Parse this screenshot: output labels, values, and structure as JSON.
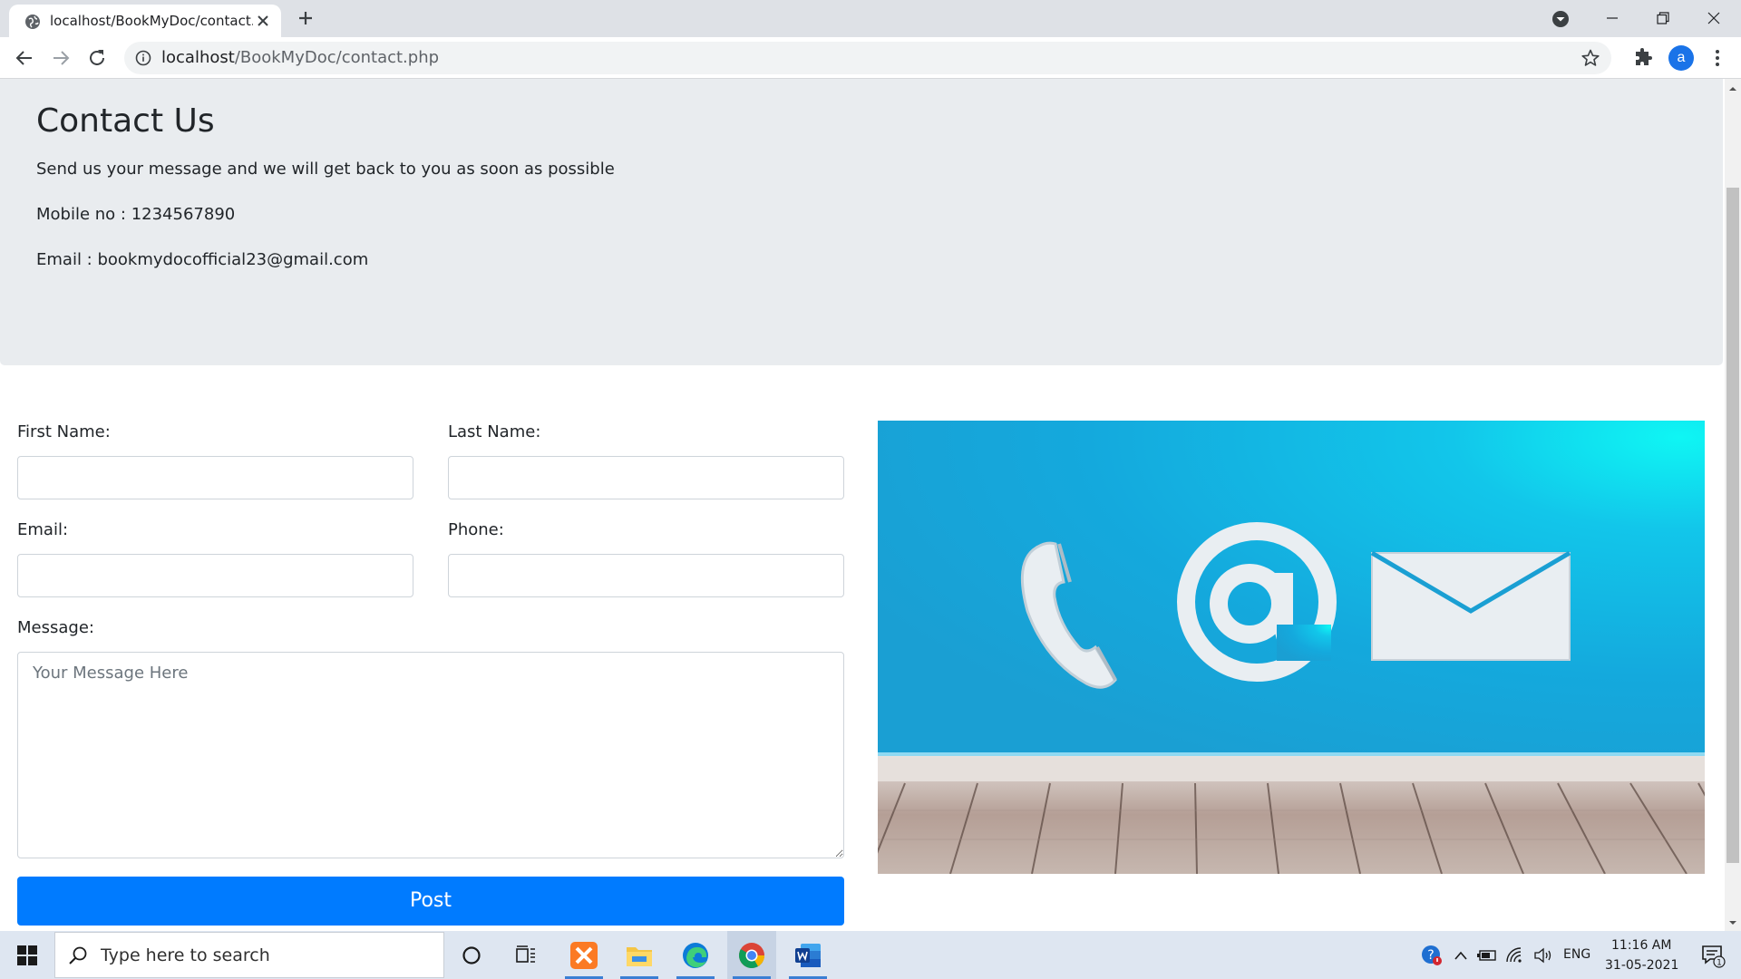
{
  "browser": {
    "tab_title": "localhost/BookMyDoc/contact.php",
    "url_host": "localhost",
    "url_path": "/BookMyDoc/contact.php",
    "avatar_letter": "a"
  },
  "jumbotron": {
    "heading": "Contact Us",
    "lead": "Send us your message and we will get back to you as soon as possible",
    "mobile": "Mobile no : 1234567890",
    "email": "Email : bookmydocofficial23@gmail.com"
  },
  "form": {
    "first_name_label": "First Name:",
    "last_name_label": "Last Name:",
    "email_label": "Email:",
    "phone_label": "Phone:",
    "message_label": "Message:",
    "message_placeholder": "Your Message Here",
    "post_label": "Post"
  },
  "taskbar": {
    "search_placeholder": "Type here to search",
    "language": "ENG",
    "time": "11:16 AM",
    "date": "31-05-2021",
    "notification_count": "1"
  },
  "colors": {
    "primary": "#007bff",
    "jumbotron_bg": "#e9ecef",
    "image_wall": "#16a6dc"
  }
}
